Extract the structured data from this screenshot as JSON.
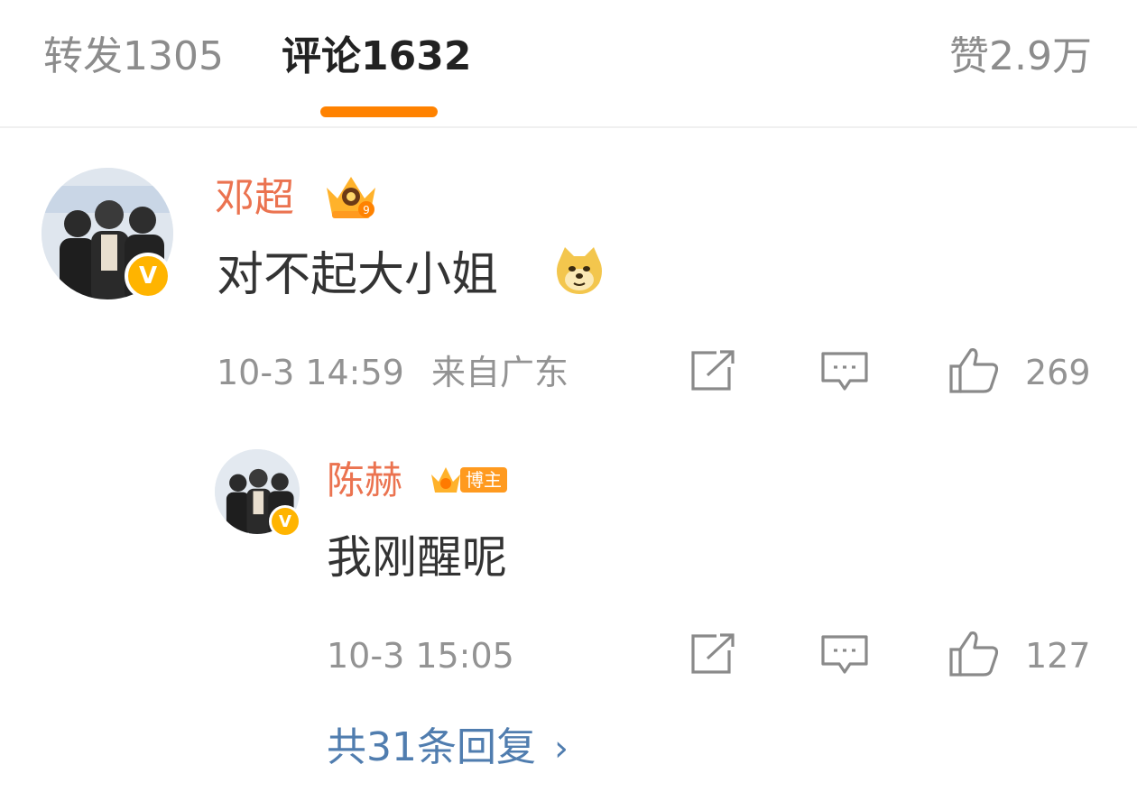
{
  "tabs": {
    "repost_label": "转发1305",
    "comment_label": "评论1632",
    "like_label": "赞2.9万"
  },
  "colors": {
    "accent": "#ff8200",
    "username": "#eb7350",
    "link": "#507daf",
    "meta": "#939393",
    "verified_badge": "#ffb400"
  },
  "comment": {
    "username": "邓超",
    "fan_badge_icon": "crown-fan-badge-icon",
    "text": "对不起大小姐",
    "emoji": "doge-emoji-icon",
    "time": "10-3 14:59",
    "location": "来自广东",
    "like_count": "269"
  },
  "reply": {
    "username": "陈赫",
    "badge_label": "博主",
    "text": "我刚醒呢",
    "time": "10-3 15:05",
    "like_count": "127"
  },
  "more_replies": {
    "label": "共31条回复",
    "chevron": "›"
  },
  "icons": {
    "share": "share-icon",
    "comment": "comment-icon",
    "like": "thumbs-up-icon",
    "verified": "verified-v-icon"
  }
}
